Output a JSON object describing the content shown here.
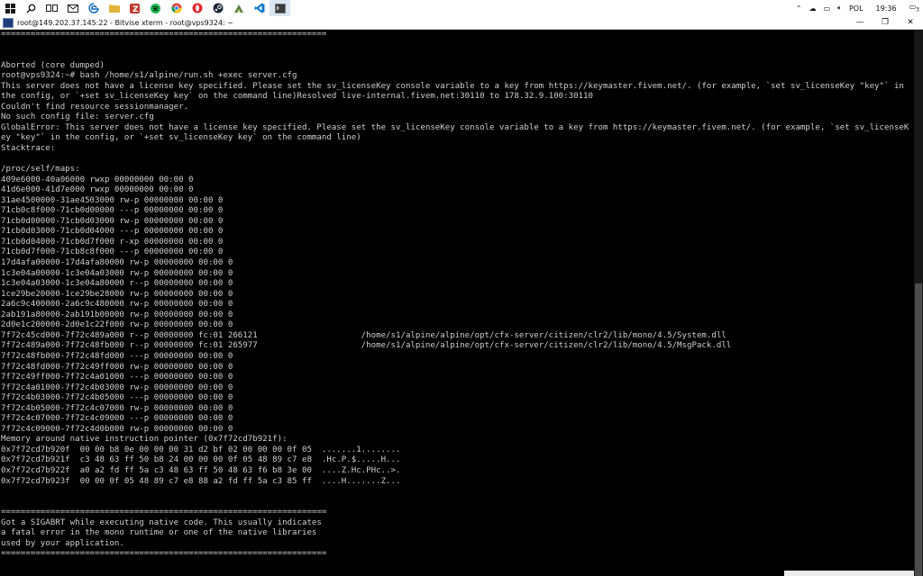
{
  "taskbar": {
    "apps": [
      {
        "name": "start-button",
        "color": "#1a1a1a"
      },
      {
        "name": "search-icon",
        "color": "#1a1a1a"
      },
      {
        "name": "task-view-icon",
        "color": "#1a1a1a"
      },
      {
        "name": "mail-icon",
        "color": "#2b579a"
      },
      {
        "name": "edge-icon",
        "color": "#0f6cbd"
      },
      {
        "name": "file-explorer-icon",
        "color": "#f2c94c"
      },
      {
        "name": "filezilla-icon",
        "color": "#c0392b"
      },
      {
        "name": "spotify-icon",
        "color": "#1db954"
      },
      {
        "name": "chrome-icon",
        "color": "#db4437"
      },
      {
        "name": "opera-icon",
        "color": "#e0262b"
      },
      {
        "name": "steam-icon",
        "color": "#1b2838"
      },
      {
        "name": "bitvise-icon",
        "color": "#5b7f3a"
      },
      {
        "name": "vscode-icon",
        "color": "#0a7acc"
      },
      {
        "name": "bitvise-xterm-icon",
        "color": "#3b3b3b"
      }
    ],
    "tray": {
      "language": "POL",
      "time": "19:36",
      "notifications": "3"
    }
  },
  "window": {
    "title": "root@149.202.37.145:22 - Bitvise xterm - root@vps9324: ~",
    "minimize": "—",
    "maximize": "❐",
    "close": "✕"
  },
  "terminal": {
    "lines": [
      "==================================================================",
      "",
      "",
      "Aborted (core dumped)",
      "root@vps9324:~# bash /home/s1/alpine/run.sh +exec server.cfg",
      "This server does not have a license key specified. Please set the sv_licenseKey console variable to a key from https://keymaster.fivem.net/. (for example, `set sv_licenseKey \"key\"` in",
      "the config, or `+set sv_licenseKey key` on the command line)Resolved live-internal.fivem.net:30110 to 178.32.9.100:30110",
      "Couldn't find resource sessionmanager.",
      "No such config file: server.cfg",
      "GlobalError: This server does not have a license key specified. Please set the sv_licenseKey console variable to a key from https://keymaster.fivem.net/. (for example, `set sv_licenseK",
      "ey \"key\"` in the config, or `+set sv_licenseKey key` on the command line)",
      "Stacktrace:",
      "",
      "/proc/self/maps:",
      "409e6000-40a06000 rwxp 00000000 00:00 0",
      "41d6e000-41d7e000 rwxp 00000000 00:00 0",
      "31ae4500000-31ae4503000 rw-p 00000000 00:00 0",
      "71cb0c8f000-71cb0d00000 ---p 00000000 00:00 0",
      "71cb0d00000-71cb0d03000 rw-p 00000000 00:00 0",
      "71cb0d03000-71cb0d04000 ---p 00000000 00:00 0",
      "71cb0d04000-71cb0d7f000 r-xp 00000000 00:00 0",
      "71cb0d7f000-71cb8c8f000 ---p 00000000 00:00 0",
      "17d4afa00000-17d4afa80000 rw-p 00000000 00:00 0",
      "1c3e04a00000-1c3e04a03000 rw-p 00000000 00:00 0",
      "1c3e04a03000-1c3e04a80000 r--p 00000000 00:00 0",
      "1ce29be20000-1ce29be28000 rw-p 00000000 00:00 0",
      "2a6c9c400000-2a6c9c480000 rw-p 00000000 00:00 0",
      "2ab191a80000-2ab191b00000 rw-p 00000000 00:00 0",
      "2d0e1c200000-2d0e1c22f000 rw-p 00000000 00:00 0",
      "7f72c45cd000-7f72c489a000 r--p 00000000 fc:01 266121                     /home/s1/alpine/alpine/opt/cfx-server/citizen/clr2/lib/mono/4.5/System.dll",
      "7f72c489a000-7f72c48fb000 r--p 00000000 fc:01 265977                     /home/s1/alpine/alpine/opt/cfx-server/citizen/clr2/lib/mono/4.5/MsgPack.dll",
      "7f72c48fb000-7f72c48fd000 ---p 00000000 00:00 0",
      "7f72c48fd000-7f72c49ff000 rw-p 00000000 00:00 0",
      "7f72c49ff000-7f72c4a01000 ---p 00000000 00:00 0",
      "7f72c4a01000-7f72c4b03000 rw-p 00000000 00:00 0",
      "7f72c4b03000-7f72c4b05000 ---p 00000000 00:00 0",
      "7f72c4b05000-7f72c4c07000 rw-p 00000000 00:00 0",
      "7f72c4c07000-7f72c4c09000 ---p 00000000 00:00 0",
      "7f72c4c09000-7f72c4d0b000 rw-p 00000000 00:00 0",
      "Memory around native instruction pointer (0x7f72cd7b921f):",
      "0x7f72cd7b920f  00 00 b8 0e 00 00 00 31 d2 bf 02 00 00 00 0f 05  .......1........",
      "0x7f72cd7b921f  c3 48 63 ff 50 b8 24 00 00 00 0f 05 48 89 c7 e8  .Hc.P.$.....H...",
      "0x7f72cd7b922f  a0 a2 fd ff 5a c3 48 63 ff 50 48 63 f6 b8 3e 00  ....Z.Hc.PHc..>.",
      "0x7f72cd7b923f  00 00 0f 05 48 89 c7 e8 88 a2 fd ff 5a c3 85 ff  ....H.......Z...",
      "",
      "",
      "==================================================================",
      "Got a SIGABRT while executing native code. This usually indicates",
      "a fatal error in the mono runtime or one of the native libraries",
      "used by your application.",
      "==================================================================",
      "",
      "",
      "Aborted (core dumped)"
    ],
    "prompt": "root@vps9324:~# "
  }
}
